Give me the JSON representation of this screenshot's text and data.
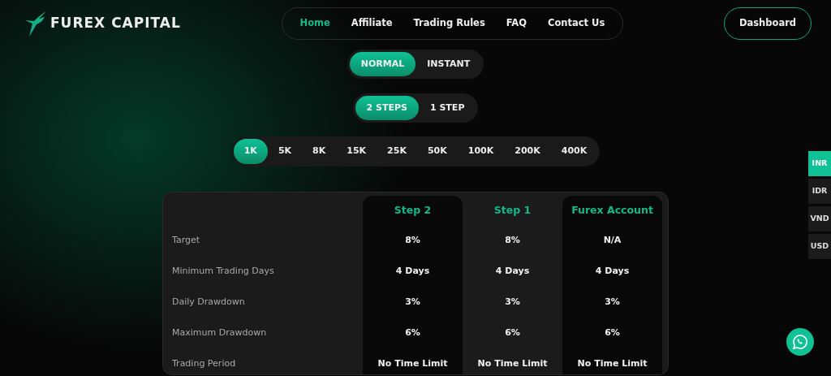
{
  "brand": {
    "name": "FUREX CAPITAL"
  },
  "nav": [
    {
      "label": "Home",
      "selected": true
    },
    {
      "label": "Affiliate",
      "selected": false
    },
    {
      "label": "Trading Rules",
      "selected": false
    },
    {
      "label": "FAQ",
      "selected": false
    },
    {
      "label": "Contact Us",
      "selected": false
    }
  ],
  "dashboard_button": "Dashboard",
  "mode_toggle": [
    {
      "label": "NORMAL",
      "selected": true
    },
    {
      "label": "INSTANT",
      "selected": false
    }
  ],
  "steps_toggle": [
    {
      "label": "2 STEPS",
      "selected": true
    },
    {
      "label": "1 STEP",
      "selected": false
    }
  ],
  "amounts": [
    {
      "label": "1K",
      "selected": true
    },
    {
      "label": "5K",
      "selected": false
    },
    {
      "label": "8K",
      "selected": false
    },
    {
      "label": "15K",
      "selected": false
    },
    {
      "label": "25K",
      "selected": false
    },
    {
      "label": "50K",
      "selected": false
    },
    {
      "label": "100K",
      "selected": false
    },
    {
      "label": "200K",
      "selected": false
    },
    {
      "label": "400K",
      "selected": false
    }
  ],
  "table": {
    "columns": [
      "Step 2",
      "Step 1",
      "Furex Account"
    ],
    "rows": [
      {
        "label": "Target",
        "values": [
          "8%",
          "8%",
          "N/A"
        ]
      },
      {
        "label": "Minimum Trading Days",
        "values": [
          "4 Days",
          "4 Days",
          "4 Days"
        ]
      },
      {
        "label": "Daily Drawdown",
        "values": [
          "3%",
          "3%",
          "3%"
        ]
      },
      {
        "label": "Maximum Drawdown",
        "values": [
          "6%",
          "6%",
          "6%"
        ]
      },
      {
        "label": "Trading Period",
        "values": [
          "No Time Limit",
          "No Time Limit",
          "No Time Limit"
        ]
      }
    ]
  },
  "currencies": [
    {
      "label": "INR",
      "selected": true
    },
    {
      "label": "IDR",
      "selected": false
    },
    {
      "label": "VND",
      "selected": false
    },
    {
      "label": "USD",
      "selected": false
    }
  ]
}
